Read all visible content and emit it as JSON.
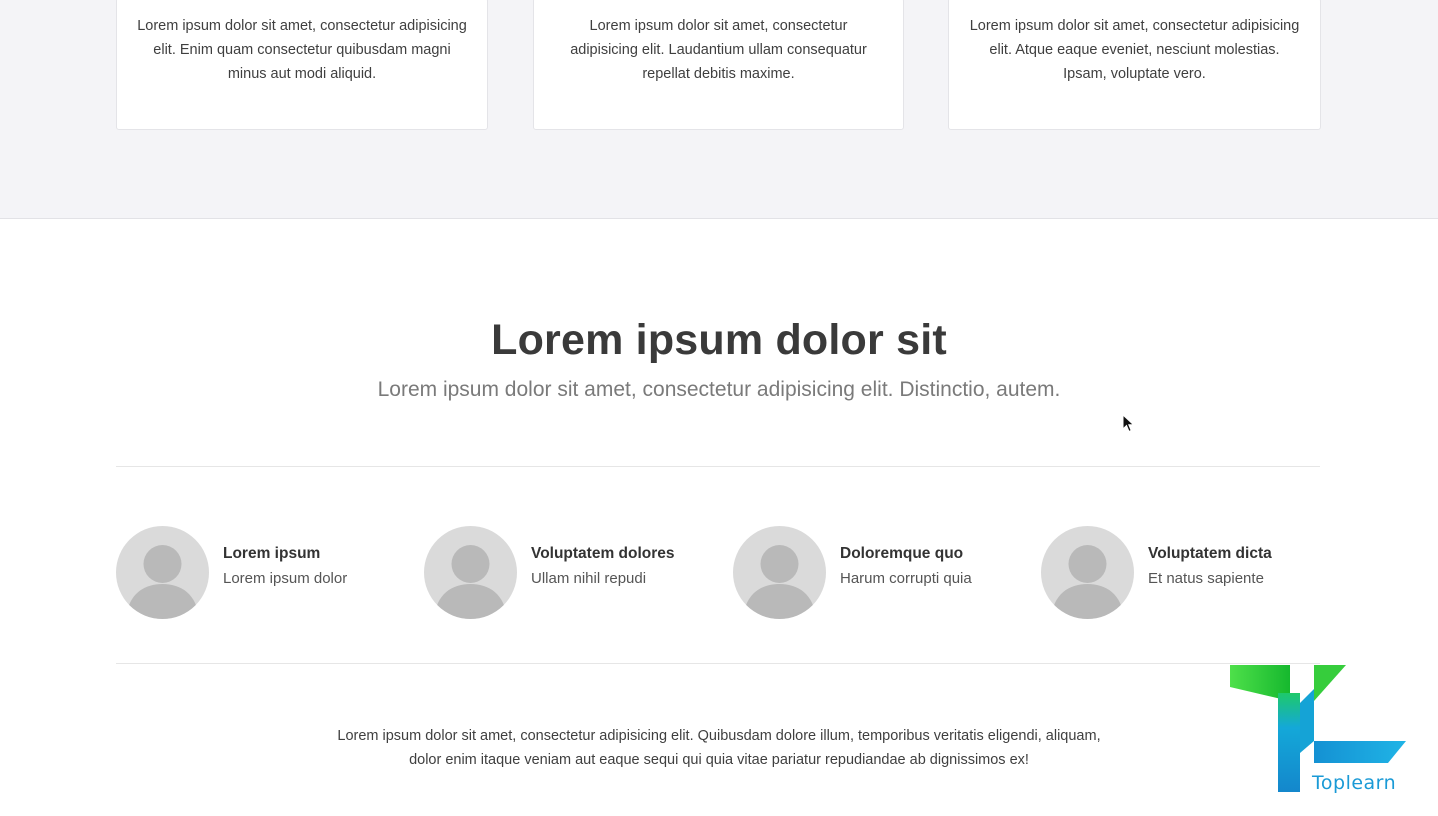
{
  "cards": [
    {
      "text": "Lorem ipsum dolor sit amet, consectetur adipisicing elit. Enim quam consectetur quibusdam magni minus aut modi aliquid."
    },
    {
      "text": "Lorem ipsum dolor sit amet, consectetur adipisicing elit. Laudantium ullam consequatur repellat debitis maxime."
    },
    {
      "text": "Lorem ipsum dolor sit amet, consectetur adipisicing elit. Atque eaque eveniet, nesciunt molestias. Ipsam, voluptate vero."
    }
  ],
  "team": {
    "title": "Lorem ipsum dolor sit",
    "subtitle": "Lorem ipsum dolor sit amet, consectetur adipisicing elit. Distinctio, autem.",
    "members": [
      {
        "name": "Lorem ipsum",
        "role": "Lorem ipsum dolor",
        "icon": "avatar-placeholder-icon"
      },
      {
        "name": "Voluptatem dolores",
        "role": "Ullam nihil repudi",
        "icon": "avatar-placeholder-icon"
      },
      {
        "name": "Doloremque quo",
        "role": "Harum corrupti quia",
        "icon": "avatar-placeholder-icon"
      },
      {
        "name": "Voluptatem dicta",
        "role": "Et natus sapiente",
        "icon": "avatar-placeholder-icon"
      }
    ],
    "footer_line1": "Lorem ipsum dolor sit amet, consectetur adipisicing elit. Quibusdam dolore illum, temporibus veritatis eligendi, aliquam,",
    "footer_line2": "dolor enim itaque veniam aut eaque sequi qui quia vitae pariatur repudiandae ab dignissimos ex!"
  },
  "watermark": {
    "text": "Toplearn",
    "colors": {
      "green": "#3ad13a",
      "blue": "#1a9ad6"
    }
  },
  "colors": {
    "band_background": "#f4f4f7",
    "heading": "#3a3a3a",
    "subheading": "#7a7a7a",
    "avatar": "#dadada"
  }
}
